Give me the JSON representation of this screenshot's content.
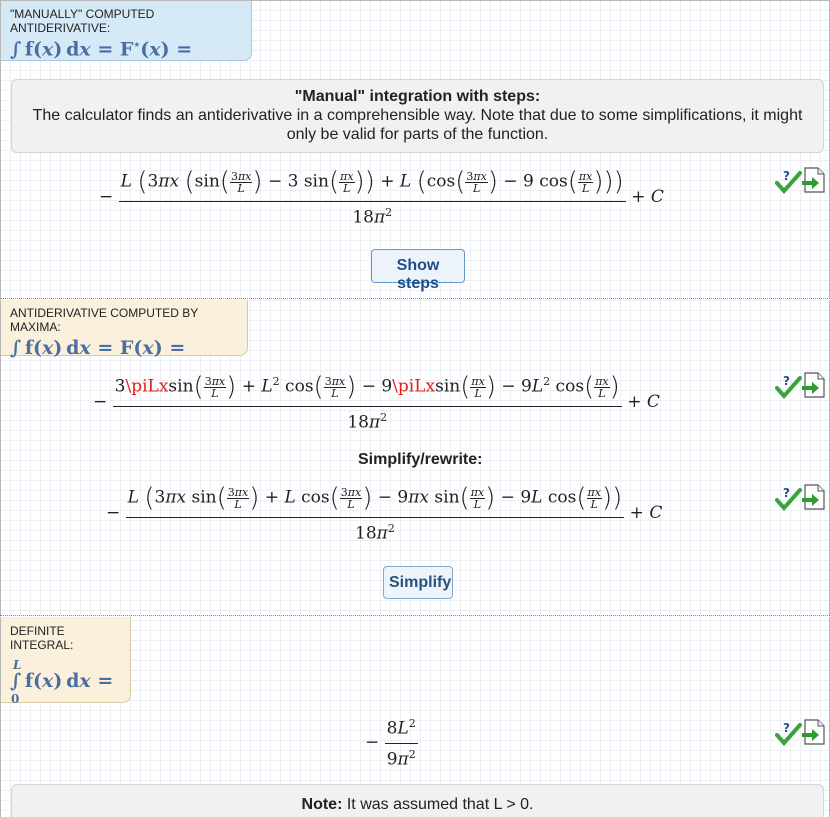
{
  "manual_section": {
    "header_title": "\"MANUALLY\" COMPUTED ANTIDERIVATIVE:",
    "header_formula": "∫ f(x) dx = F*(x) =",
    "info_heading": "\"Manual\" integration with steps:",
    "info_text": "The calculator finds an antiderivative in a comprehensible way. Note that due to some simplifications, it might only be valid for parts of the function.",
    "result": "−L(3πx(sin(3πx/L) − 3 sin(πx/L)) + L(cos(3πx/L) − 9 cos(πx/L)))/(18π²) + C",
    "show_steps_label": "Show steps"
  },
  "maxima_section": {
    "header_title": "ANTIDERIVATIVE COMPUTED BY MAXIMA:",
    "header_formula": "∫ f(x) dx = F(x) =",
    "result": "−(3\\piLx sin(3πx/L) + L² cos(3πx/L) − 9\\piLx sin(πx/L) − 9L² cos(πx/L))/(18π²) + C",
    "red_token": "\\piLx",
    "simplify_heading": "Simplify/rewrite:",
    "simplified_result": "−L(3πx sin(3πx/L) + L cos(3πx/L) − 9πx sin(πx/L) − 9L cos(πx/L))/(18π²) + C",
    "simplify_label": "Simplify"
  },
  "definite_section": {
    "header_title": "DEFINITE INTEGRAL:",
    "upper_limit": "L",
    "lower_limit": "0",
    "header_formula": "∫ f(x) dx =",
    "result": "−8L²/(9π²)",
    "note_label": "Note:",
    "note_text": "It was assumed that L > 0."
  },
  "icons": {
    "check": "check-question-icon",
    "export": "document-export-icon",
    "check_color": "#3aa33a",
    "export_color": "#2f9a2f"
  },
  "colors": {
    "header_blue": "#d5e9f7",
    "header_beige": "#faf0db",
    "formula_text": "#4a6ea0",
    "button_text": "#1c4f86",
    "highlight_red": "#e0201b"
  }
}
